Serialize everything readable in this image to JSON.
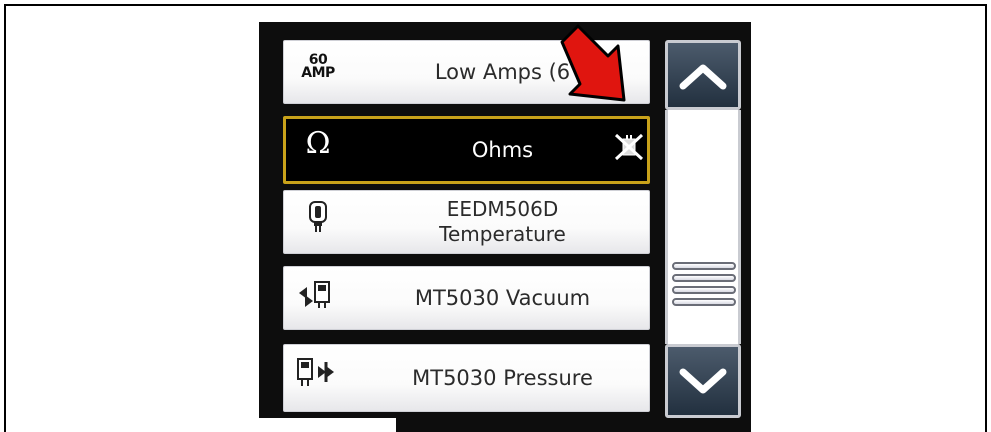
{
  "list": {
    "items": [
      {
        "label": "Low Amps (6",
        "icon": "60-amp-icon",
        "icon_text_top": "60",
        "icon_text_bottom": "AMP",
        "selected": false
      },
      {
        "label": "Ohms",
        "icon": "omega-icon",
        "icon_text": "Ω",
        "selected": true
      },
      {
        "label": "EEDM506D\nTemperature",
        "icon": "temperature-probe-icon",
        "selected": false
      },
      {
        "label": "MT5030 Vacuum",
        "icon": "vacuum-gauge-icon",
        "selected": false
      },
      {
        "label": "MT5030 Pressure",
        "icon": "pressure-gauge-icon",
        "selected": false
      }
    ]
  },
  "scrollbar": {
    "up_icon": "chevron-up-icon",
    "down_icon": "chevron-down-icon",
    "thumb_icon": "scroll-grip-icon"
  },
  "annotation": {
    "arrow_color": "#e0150f",
    "description_icon": "red-arrow-icon",
    "disconnected_icon": "disconnected-lead-icon"
  },
  "colors": {
    "selected_border": "#c9a21a",
    "selected_background": "#000000",
    "scroll_button": "#3a4757"
  }
}
